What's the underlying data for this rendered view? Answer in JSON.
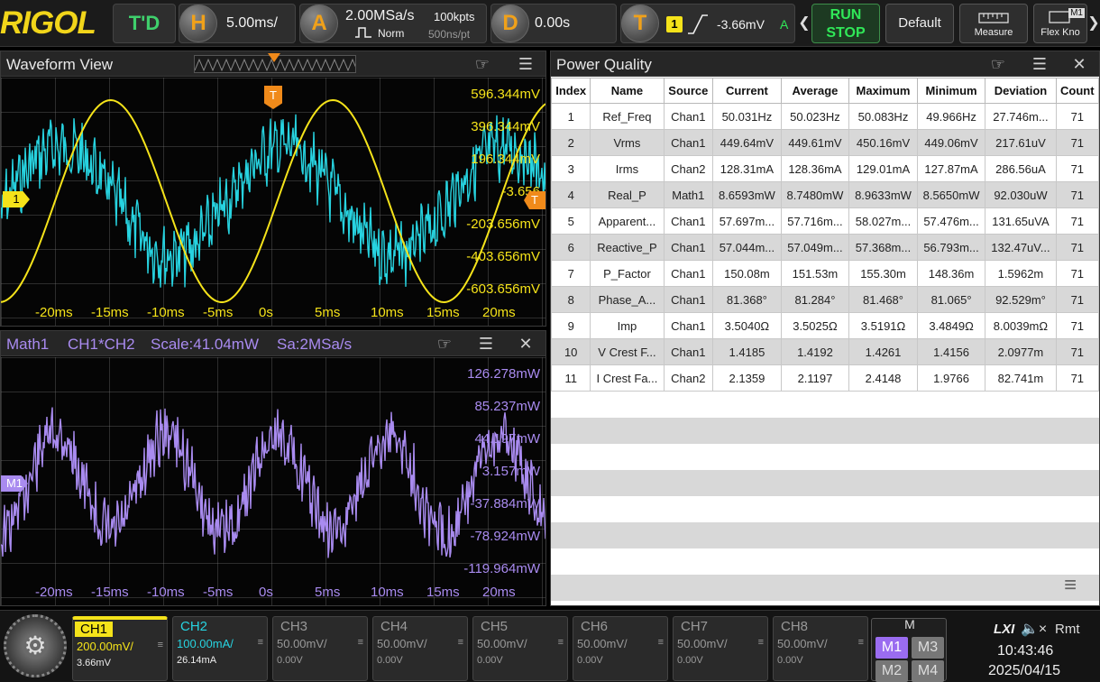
{
  "topbar": {
    "logo": "RIGOL",
    "td_label": "T'D",
    "h_label": "H",
    "timebase": "5.00ms/",
    "a_label": "A",
    "sample_rate": "2.00MSa/s",
    "mem_depth": "100kpts",
    "acq_mode": "Norm",
    "pts_time": "500ns/pt",
    "d_label": "D",
    "delay": "0.00s",
    "t_label": "T",
    "trig_source": "1",
    "trig_level": "-3.66mV",
    "trig_status": "A",
    "run_label": "RUN",
    "stop_label": "STOP",
    "default_label": "Default",
    "measure_label": "Measure",
    "flex_label": "Flex Kno",
    "flex_badge": "M1"
  },
  "waveform": {
    "title": "Waveform View",
    "ch1_marker": "1",
    "trig_marker": "T",
    "y_labels": [
      "596.344mV",
      "396.344mV",
      "196.344mV",
      "-3.656",
      "-203.656mV",
      "-403.656mV",
      "-603.656mV"
    ],
    "x_labels": [
      "-20ms",
      "-15ms",
      "-10ms",
      "-5ms",
      "0s",
      "5ms",
      "10ms",
      "15ms",
      "20ms"
    ]
  },
  "math": {
    "title": "Math1",
    "expr": "CH1*CH2",
    "scale": "Scale:41.04mW",
    "sa": "Sa:2MSa/s",
    "marker": "M1",
    "y_labels": [
      "126.278mW",
      "85.237mW",
      "44.197mW",
      "3.157mW",
      "-37.884mW",
      "-78.924mW",
      "-119.964mW"
    ],
    "x_labels": [
      "-20ms",
      "-15ms",
      "-10ms",
      "-5ms",
      "0s",
      "5ms",
      "10ms",
      "15ms",
      "20ms"
    ]
  },
  "pq": {
    "title": "Power Quality",
    "headers": [
      "Index",
      "Name",
      "Source",
      "Current",
      "Average",
      "Maximum",
      "Minimum",
      "Deviation",
      "Count"
    ],
    "rows": [
      [
        "1",
        "Ref_Freq",
        "Chan1",
        "50.031Hz",
        "50.023Hz",
        "50.083Hz",
        "49.966Hz",
        "27.746m...",
        "71"
      ],
      [
        "2",
        "Vrms",
        "Chan1",
        "449.64mV",
        "449.61mV",
        "450.16mV",
        "449.06mV",
        "217.61uV",
        "71"
      ],
      [
        "3",
        "Irms",
        "Chan2",
        "128.31mA",
        "128.36mA",
        "129.01mA",
        "127.87mA",
        "286.56uA",
        "71"
      ],
      [
        "4",
        "Real_P",
        "Math1",
        "8.6593mW",
        "8.7480mW",
        "8.9633mW",
        "8.5650mW",
        "92.030uW",
        "71"
      ],
      [
        "5",
        "Apparent...",
        "Chan1",
        "57.697m...",
        "57.716m...",
        "58.027m...",
        "57.476m...",
        "131.65uVA",
        "71"
      ],
      [
        "6",
        "Reactive_P",
        "Chan1",
        "57.044m...",
        "57.049m...",
        "57.368m...",
        "56.793m...",
        "132.47uV...",
        "71"
      ],
      [
        "7",
        "P_Factor",
        "Chan1",
        "150.08m",
        "151.53m",
        "155.30m",
        "148.36m",
        "1.5962m",
        "71"
      ],
      [
        "8",
        "Phase_A...",
        "Chan1",
        "81.368°",
        "81.284°",
        "81.468°",
        "81.065°",
        "92.529m°",
        "71"
      ],
      [
        "9",
        "Imp",
        "Chan1",
        "3.5040Ω",
        "3.5025Ω",
        "3.5191Ω",
        "3.4849Ω",
        "8.0039mΩ",
        "71"
      ],
      [
        "10",
        "V Crest F...",
        "Chan1",
        "1.4185",
        "1.4192",
        "1.4261",
        "1.4156",
        "2.0977m",
        "71"
      ],
      [
        "11",
        "I Crest Fa...",
        "Chan2",
        "2.1359",
        "2.1197",
        "2.4148",
        "1.9766",
        "82.741m",
        "71"
      ]
    ]
  },
  "channels": [
    {
      "name": "CH1",
      "scale": "200.00mV/",
      "offset": "3.66mV",
      "color": "#f5e31a",
      "active": true
    },
    {
      "name": "CH2",
      "scale": "100.00mA/",
      "offset": "26.14mA",
      "color": "#27d3e0",
      "active": true
    },
    {
      "name": "CH3",
      "scale": "50.00mV/",
      "offset": "0.00V",
      "color": "#999999",
      "active": false
    },
    {
      "name": "CH4",
      "scale": "50.00mV/",
      "offset": "0.00V",
      "color": "#999999",
      "active": false
    },
    {
      "name": "CH5",
      "scale": "50.00mV/",
      "offset": "0.00V",
      "color": "#999999",
      "active": false
    },
    {
      "name": "CH6",
      "scale": "50.00mV/",
      "offset": "0.00V",
      "color": "#999999",
      "active": false
    },
    {
      "name": "CH7",
      "scale": "50.00mV/",
      "offset": "0.00V",
      "color": "#999999",
      "active": false
    },
    {
      "name": "CH8",
      "scale": "50.00mV/",
      "offset": "0.00V",
      "color": "#999999",
      "active": false
    }
  ],
  "math_group": {
    "label": "M",
    "m1": "M1",
    "m2": "M2",
    "m3": "M3",
    "m4": "M4"
  },
  "status": {
    "lxi": "LXI",
    "rmt": "Rmt",
    "time": "10:43:46",
    "date": "2025/04/15"
  },
  "colors": {
    "ch1": "#f5e31a",
    "ch2": "#27d3e0",
    "math": "#a98bf0",
    "trigger": "#f08a1a",
    "run": "#30e858"
  },
  "icons": [
    "touch-icon",
    "menu-icon",
    "close-icon",
    "gear-icon",
    "speaker-mute-icon",
    "lxi-icon",
    "trigger-edge-icon",
    "acq-mode-icon",
    "collapse-icon"
  ]
}
